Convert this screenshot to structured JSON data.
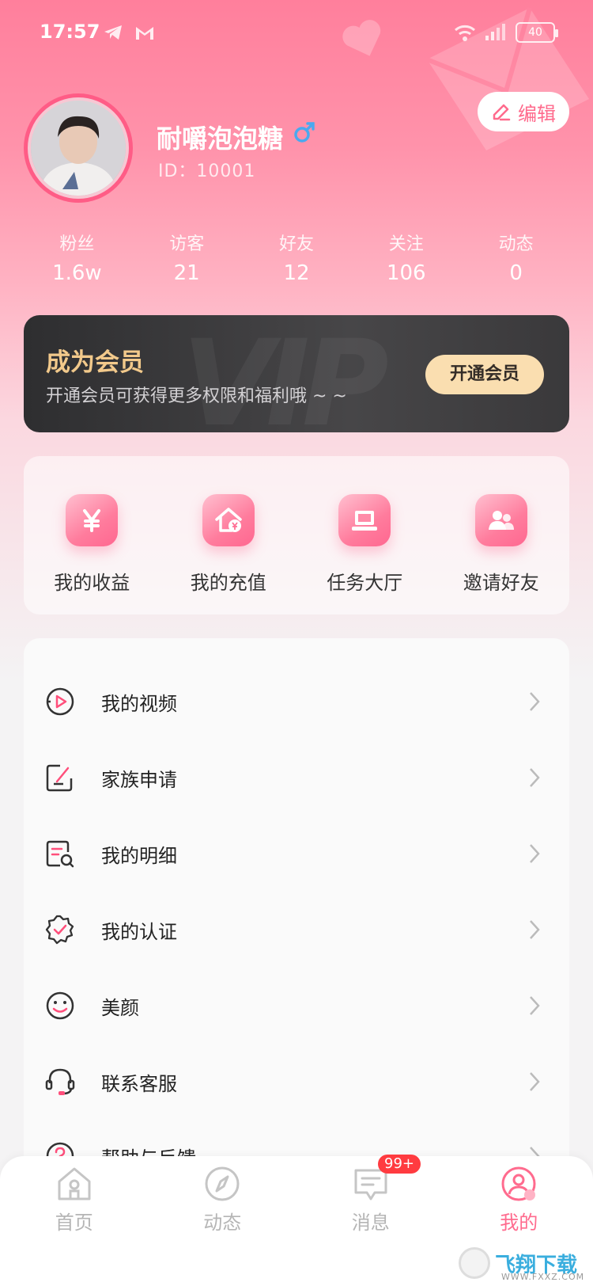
{
  "status_bar": {
    "time": "17:57",
    "battery": "40"
  },
  "profile": {
    "nickname": "耐嚼泡泡糖",
    "user_id": "ID：10001",
    "edit_label": "编辑",
    "gender_icon": "male-icon"
  },
  "stats": [
    {
      "label": "粉丝",
      "value": "1.6w"
    },
    {
      "label": "访客",
      "value": "21"
    },
    {
      "label": "好友",
      "value": "12"
    },
    {
      "label": "关注",
      "value": "106"
    },
    {
      "label": "动态",
      "value": "0"
    }
  ],
  "vip": {
    "title": "成为会员",
    "description": "开通会员可获得更多权限和福利哦 ~ ~",
    "button": "开通会员",
    "watermark": "VIP"
  },
  "quick_actions": [
    {
      "label": "我的收益",
      "icon": "yuan-icon"
    },
    {
      "label": "我的充值",
      "icon": "house-coin-icon"
    },
    {
      "label": "任务大厅",
      "icon": "laptop-icon"
    },
    {
      "label": "邀请好友",
      "icon": "friends-icon"
    }
  ],
  "menu": [
    {
      "label": "我的视频",
      "icon": "video-icon"
    },
    {
      "label": "家族申请",
      "icon": "edit-square-icon"
    },
    {
      "label": "我的明细",
      "icon": "document-search-icon"
    },
    {
      "label": "我的认证",
      "icon": "badge-check-icon"
    },
    {
      "label": "美颜",
      "icon": "smile-icon"
    },
    {
      "label": "联系客服",
      "icon": "headset-icon"
    },
    {
      "label": "帮助与反馈",
      "icon": "help-icon"
    }
  ],
  "bottom_nav": [
    {
      "label": "首页",
      "icon": "home-icon"
    },
    {
      "label": "动态",
      "icon": "compass-icon"
    },
    {
      "label": "消息",
      "icon": "message-icon",
      "badge": "99+"
    },
    {
      "label": "我的",
      "icon": "profile-icon"
    }
  ],
  "colors": {
    "accent": "#ff6b8e",
    "vip_gold": "#f2c98b",
    "badge_red": "#ff3b40"
  },
  "watermark": {
    "text": "飞翔下载",
    "sub": "WWW.FXXZ.COM"
  }
}
